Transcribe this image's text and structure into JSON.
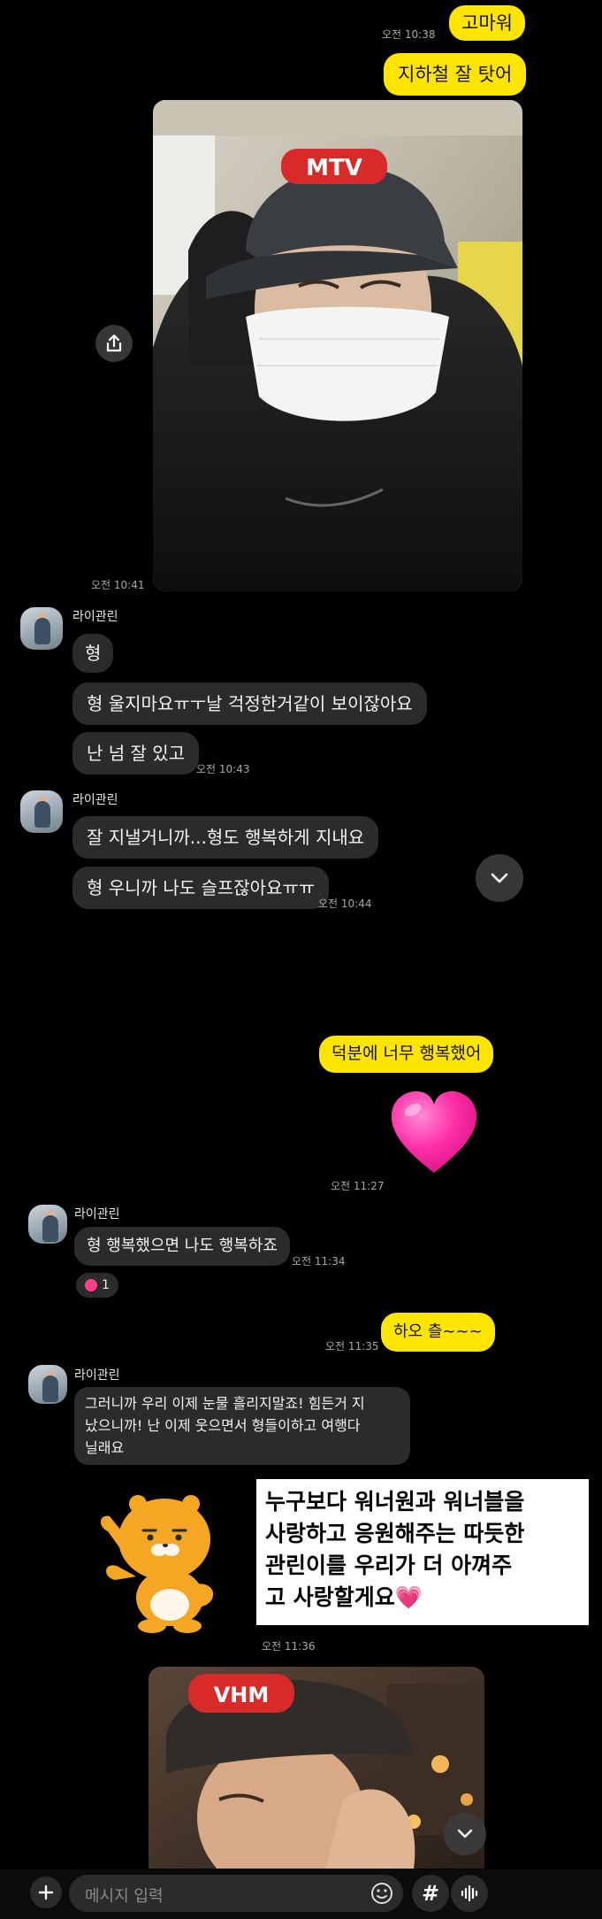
{
  "messages": {
    "m1_text": "고마워",
    "m1_time": "오전 10:38",
    "m2_text": "지하철 잘 탓어",
    "photo1_time": "오전 10:41",
    "sender_name": "라이관린",
    "g1_text": "형",
    "g2_text": "형 울지마요ㅠㅜ날 걱정한거같이 보이잖아요",
    "g3_text": "난 넘 잘 있고",
    "g3_time": "오전 10:43",
    "g4_text": "잘 지낼거니까...형도 행복하게 지내요",
    "g5_text": "형 우니까 나도 슬프잖아요ㅠㅠ",
    "g5_time": "오전 10:44",
    "y3_text": "덕분에 너무 행복했어",
    "heart_time": "오전 11:27",
    "g6_text": "형 행복했으면 나도 행복하죠",
    "g6_time": "오전 11:34",
    "reaction_count": "1",
    "y4_text": "하오 츨~~~",
    "y4_time": "오전 11:35",
    "g7_line1": "그러니까 우리 이제 눈물 흘리지말죠! 힘든거 지",
    "g7_line2": "났으니까! 난 이제 웃으면서 형들이하고 여행다",
    "g7_line3": "닐래요",
    "sticker_time": "오전 11:36"
  },
  "caption": {
    "line1": "누구보다 워너원과 워너블을",
    "line2": "사랑하고 응원해주는 따듯한",
    "line3": "관린이를 우리가 더 아껴주",
    "line4": "고 사랑할게요",
    "emoji": "💗"
  },
  "photo_caps": {
    "cap1": "MTV",
    "cap2": "VHM"
  },
  "input_bar": {
    "placeholder": "메시지 입력",
    "hash_label": "#"
  },
  "icons": {
    "share": "share-icon",
    "scroll_down": "chevron-down-icon",
    "plus": "plus-icon",
    "emoji": "emoji-icon",
    "voice": "voice-icon"
  },
  "colors": {
    "my_bubble": "#fee500",
    "other_bubble": "#2b2b2b",
    "background": "#000000",
    "heart": "#ff2fa8"
  }
}
